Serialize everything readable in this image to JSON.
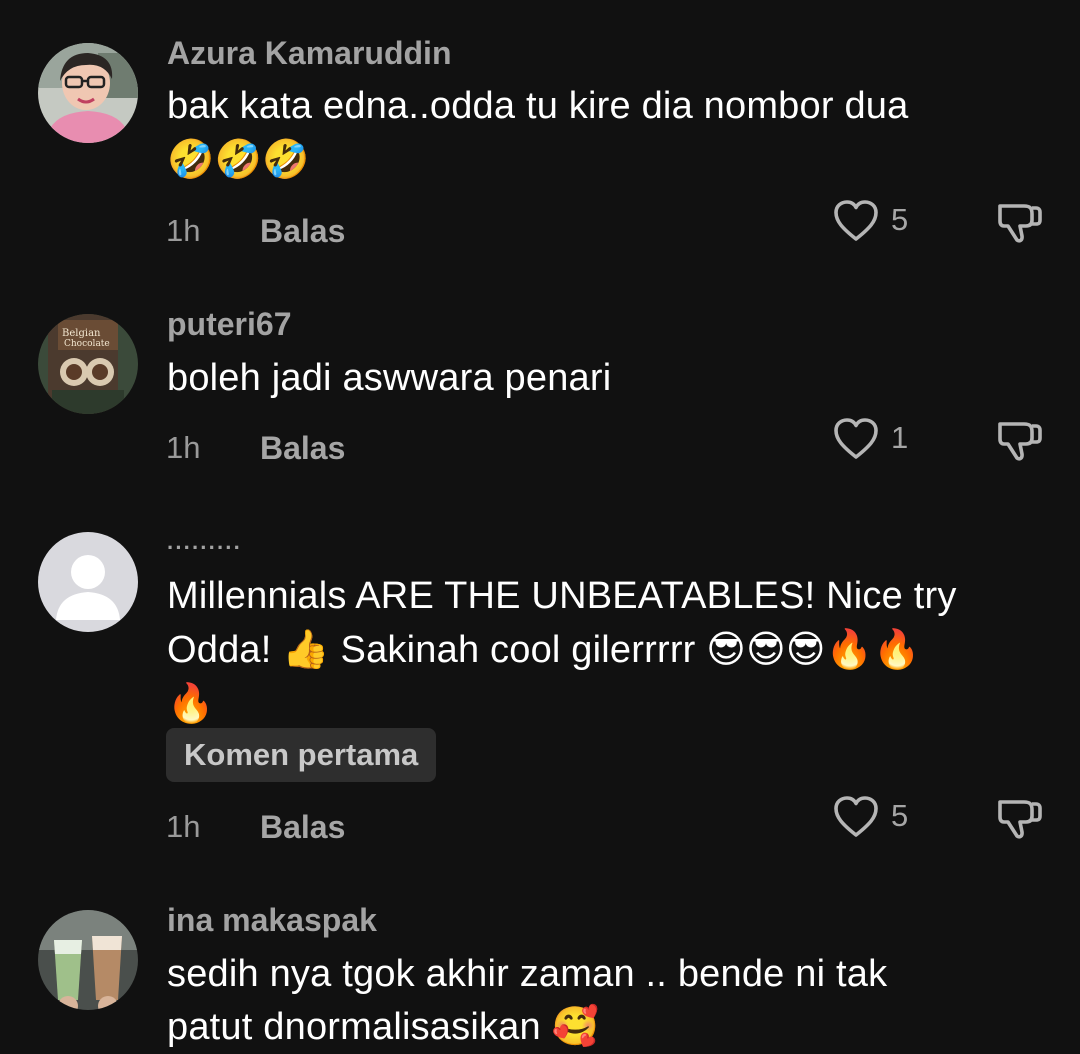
{
  "comments": [
    {
      "username": "Azura Kamaruddin",
      "line1": "bak kata edna..odda tu kire dia nombor dua",
      "line2": "🤣🤣🤣",
      "time": "1h",
      "reply": "Balas",
      "likes": "5",
      "avatar_icon": "profile-photo-woman-glasses"
    },
    {
      "username": "puteri67",
      "line1": "boleh jadi aswwara penari",
      "time": "1h",
      "reply": "Balas",
      "likes": "1",
      "avatar_icon": "profile-photo-chocolate"
    },
    {
      "username": "·········",
      "line1": "Millennials ARE THE UNBEATABLES! Nice try",
      "line2_text": "Odda! ",
      "line2_emoji_a": "👍",
      "line2_text_b": " Sakinah cool gilerrrrr ",
      "line2_emoji_b": "😎😎😎🔥🔥",
      "line3": "🔥",
      "badge": "Komen pertama",
      "time": "1h",
      "reply": "Balas",
      "likes": "5",
      "avatar_icon": "default-avatar-icon"
    },
    {
      "username": "ina makaspak",
      "line1": "sedih nya tgok akhir zaman .. bende ni tak",
      "line2": "patut dnormalisasikan 🥰",
      "avatar_icon": "profile-photo-drinks"
    }
  ],
  "colors": {
    "background": "#111111",
    "username": "#a3a3a3",
    "body_text": "#ffffff",
    "meta_text": "#9a9a9a",
    "badge_bg": "#2e2e2e",
    "icon": "#b5b5b5"
  }
}
